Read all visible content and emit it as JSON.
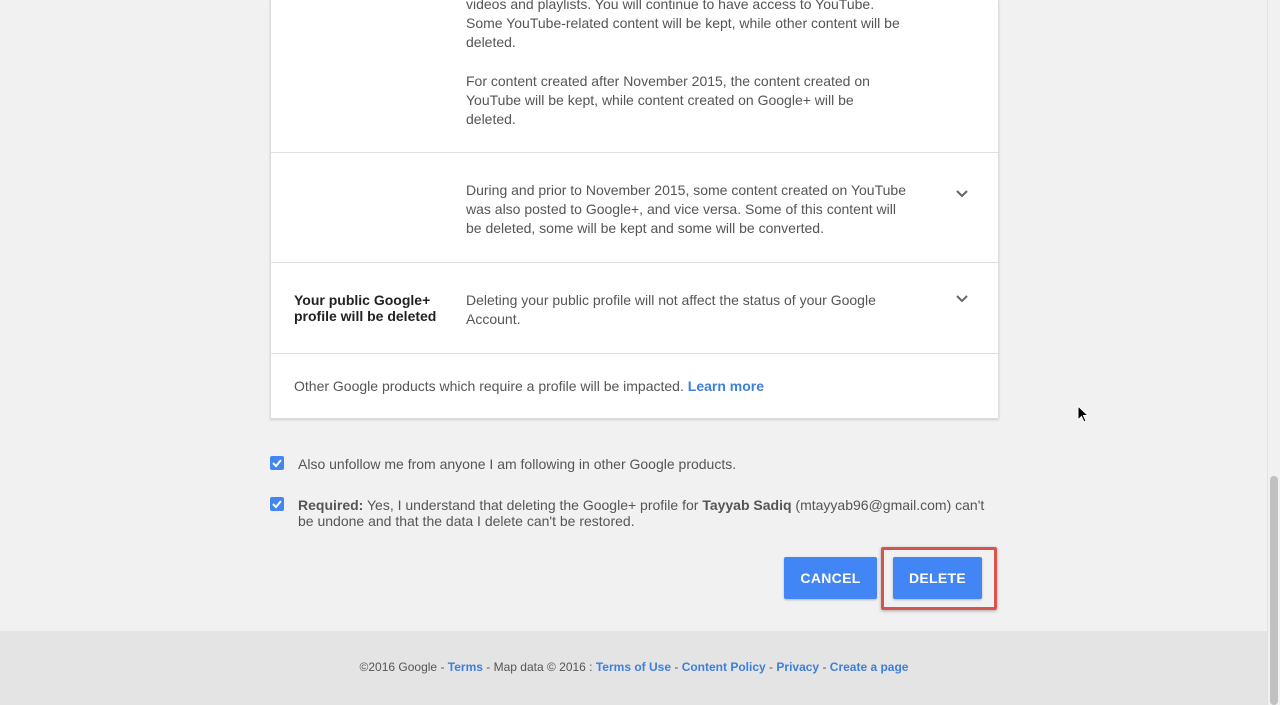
{
  "card": {
    "youtube_partial_tail": "videos and playlists. You will continue to have access to YouTube. Some YouTube-related content will be kept, while other content will be deleted.",
    "youtube_after_2015": "For content created after November 2015, the content created on YouTube will be kept, while content created on Google+ will be deleted.",
    "youtube_prior_2015": "During and prior to November 2015, some content created on YouTube was also posted to Google+, and vice versa. Some of this content will be deleted, some will be kept and some will be converted.",
    "profile_label": "Your public Google+ profile will be deleted",
    "profile_desc": "Deleting your public profile will not affect the status of your Google Account.",
    "other_products": "Other Google products which require a profile will be impacted.",
    "learn_more": "Learn more",
    "chevron_icon": "chevron-down-icon"
  },
  "checks": {
    "unfollow": "Also unfollow me from anyone I am following in other Google products.",
    "required_label": "Required:",
    "required_pre": "Yes, I understand that deleting the Google+ profile for",
    "user_name": "Tayyab Sadiq",
    "required_post": "(mtayyab96@gmail.com) can't be undone and that the data I delete can't be restored.",
    "checkbox_color": "#4285f4"
  },
  "buttons": {
    "cancel": "CANCEL",
    "delete": "DELETE",
    "button_color": "#4285f4",
    "highlight_color": "#d9534f"
  },
  "footer": {
    "copyright": "©2016 Google",
    "terms": "Terms",
    "map_data": "Map data © 2016 :",
    "terms_of_use": "Terms of Use",
    "content_policy": "Content Policy",
    "privacy": "Privacy",
    "create_page": "Create a page",
    "separator": "-"
  }
}
